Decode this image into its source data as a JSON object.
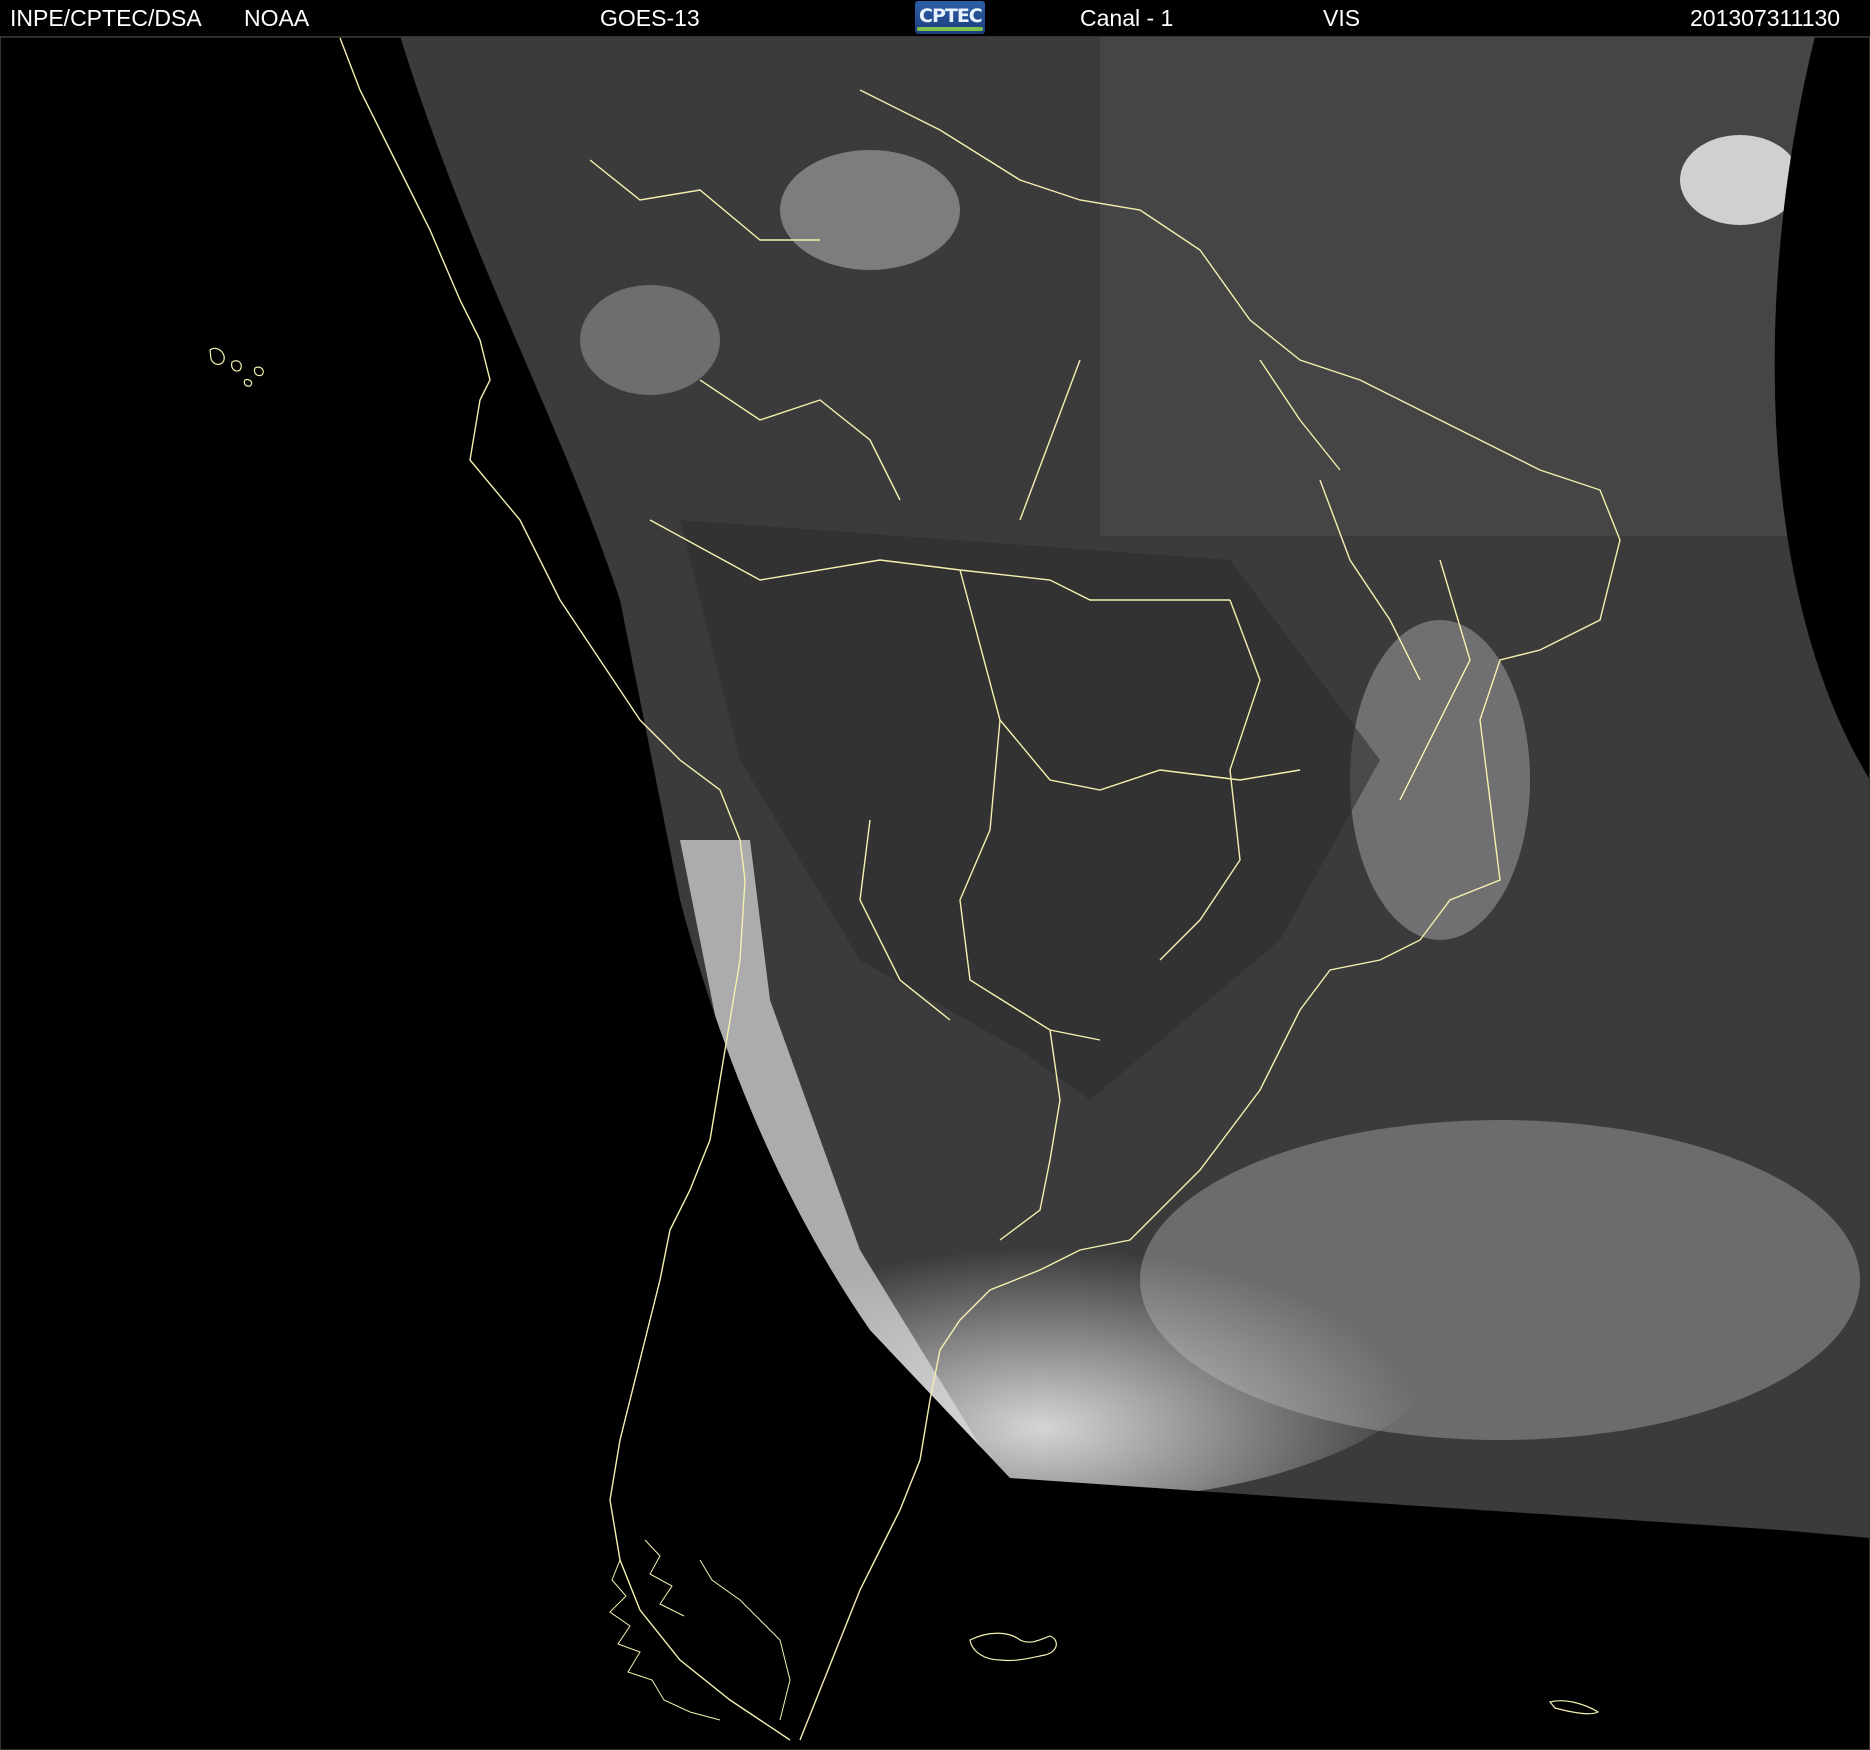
{
  "header": {
    "agency": "INPE/CPTEC/DSA",
    "source": "NOAA",
    "satellite": "GOES-13",
    "logo_text": "CPTEC",
    "channel": "Canal - 1",
    "band": "VIS",
    "timestamp": "201307311130"
  },
  "colors": {
    "background": "#000000",
    "header_text": "#ffffff",
    "coastline": "#f4f0b0",
    "logo_blue": "#2c5fa8",
    "logo_green": "#7fc24a"
  },
  "map": {
    "type": "satellite-visible-image",
    "region": "South America",
    "icons": [
      "cptec-logo-icon"
    ]
  }
}
